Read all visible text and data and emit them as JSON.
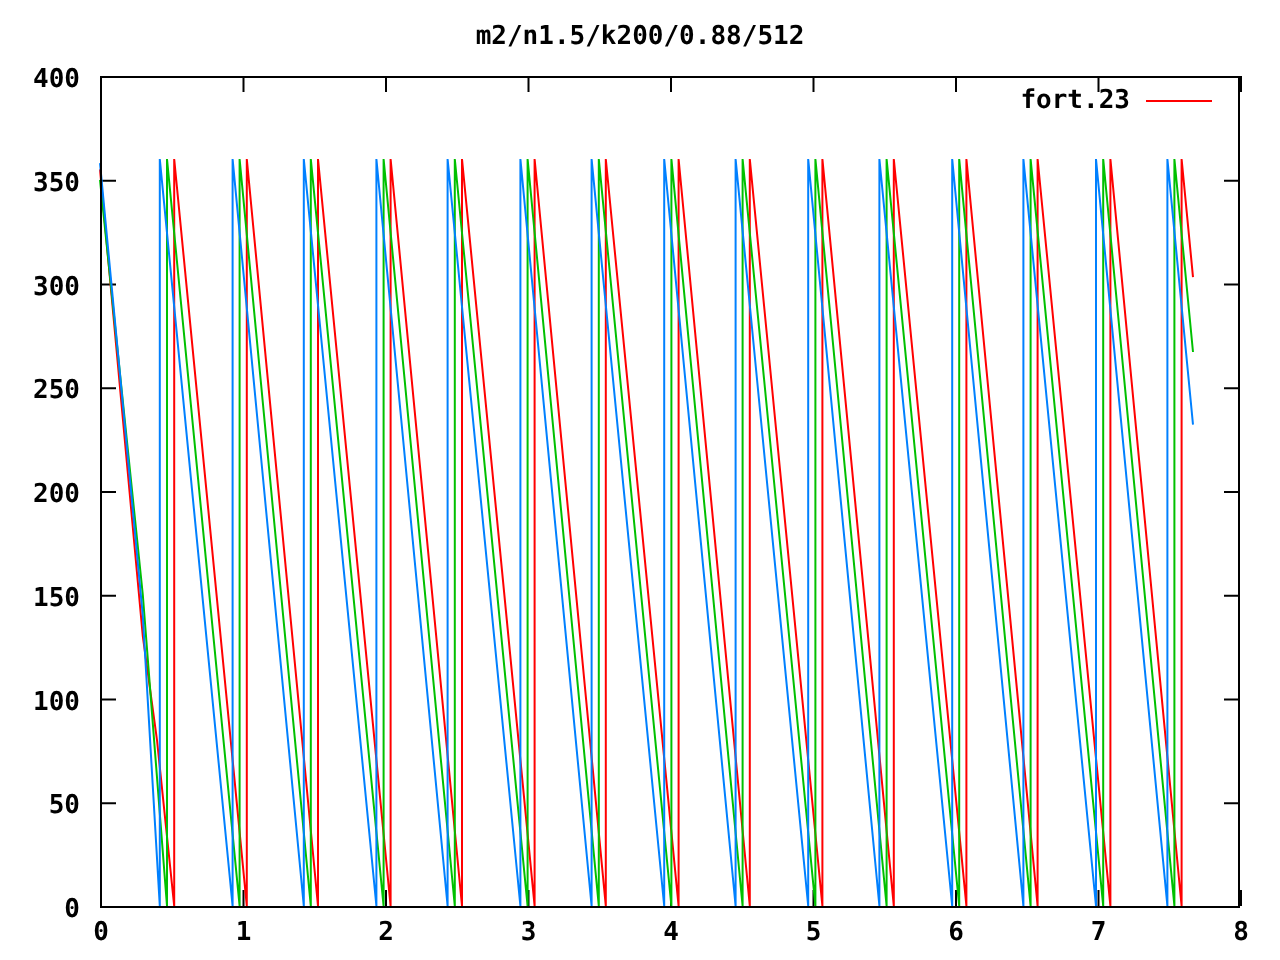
{
  "chart_data": {
    "type": "line",
    "title": "m2/n1.5/k200/0.88/512",
    "xlim": [
      0,
      8
    ],
    "ylim": [
      0,
      400
    ],
    "xticks": [
      0,
      1,
      2,
      3,
      4,
      5,
      6,
      7,
      8
    ],
    "yticks": [
      0,
      50,
      100,
      150,
      200,
      250,
      300,
      350,
      400
    ],
    "series": [
      {
        "name": "fort.23",
        "color": "#ff0000",
        "x": [
          0,
          0.3,
          0.4,
          0.52,
          0.52,
          1.03,
          1.03,
          1.53,
          1.53,
          2.04,
          2.04,
          2.54,
          2.54,
          3.05,
          3.05,
          3.55,
          3.55,
          4.06,
          4.06,
          4.56,
          4.56,
          5.07,
          5.07,
          5.57,
          5.57,
          6.08,
          6.08,
          6.58,
          6.58,
          7.09,
          7.09,
          7.59,
          7.59,
          7.67
        ],
        "values": [
          355,
          130,
          80,
          0,
          360,
          0,
          360,
          0,
          360,
          0,
          360,
          0,
          360,
          0,
          360,
          0,
          360,
          0,
          360,
          0,
          360,
          0,
          360,
          0,
          360,
          0,
          360,
          0,
          360,
          0,
          360,
          0,
          360,
          303
        ]
      },
      {
        "color": "#00c000",
        "x": [
          0,
          0.3,
          0.47,
          0.47,
          0.98,
          0.98,
          1.48,
          1.48,
          1.99,
          1.99,
          2.49,
          2.49,
          3.0,
          3.0,
          3.5,
          3.5,
          4.01,
          4.01,
          4.51,
          4.51,
          5.02,
          5.02,
          5.52,
          5.52,
          6.03,
          6.03,
          6.53,
          6.53,
          7.04,
          7.04,
          7.54,
          7.54,
          7.67
        ],
        "values": [
          350,
          150,
          0,
          360,
          0,
          360,
          0,
          360,
          0,
          360,
          0,
          360,
          0,
          360,
          0,
          360,
          0,
          360,
          0,
          360,
          0,
          360,
          0,
          360,
          0,
          360,
          0,
          360,
          0,
          360,
          0,
          360,
          267
        ]
      },
      {
        "color": "#0080ff",
        "x": [
          0,
          0.3,
          0.42,
          0.42,
          0.93,
          0.93,
          1.43,
          1.43,
          1.94,
          1.94,
          2.44,
          2.44,
          2.95,
          2.95,
          3.45,
          3.45,
          3.96,
          3.96,
          4.46,
          4.46,
          4.97,
          4.97,
          5.47,
          5.47,
          5.98,
          5.98,
          6.48,
          6.48,
          6.99,
          6.99,
          7.49,
          7.49,
          7.67
        ],
        "values": [
          358,
          140,
          0,
          360,
          0,
          360,
          0,
          360,
          0,
          360,
          0,
          360,
          0,
          360,
          0,
          360,
          0,
          360,
          0,
          360,
          0,
          360,
          0,
          360,
          0,
          360,
          0,
          360,
          0,
          360,
          0,
          360,
          232
        ]
      }
    ]
  }
}
